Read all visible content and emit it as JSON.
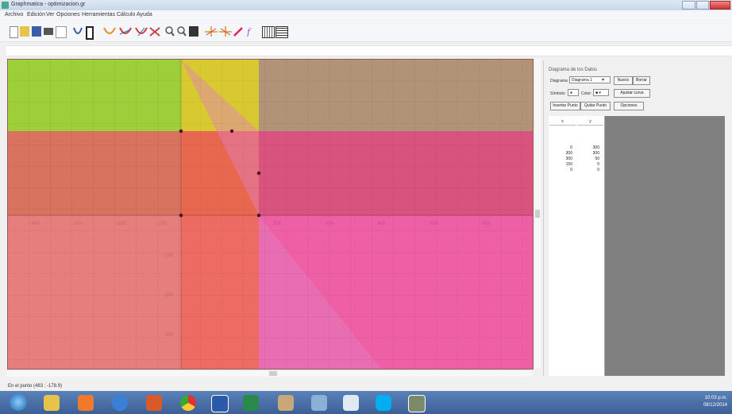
{
  "window": {
    "title": "Graphmatica - optimizacion.gr"
  },
  "menu": [
    "Archivo",
    "Edición",
    "Ver",
    "Opciones",
    "Herramientas",
    "Cálculo",
    "Ayuda"
  ],
  "toolbar_icons": [
    "new-file-icon",
    "open-folder-icon",
    "save-icon",
    "print-icon",
    "copy-icon",
    "draw-curve-icon",
    "table-icon",
    "tangent-icon",
    "derivative-icon",
    "integral-icon",
    "point-icon",
    "zoom-in-icon",
    "zoom-out-icon",
    "grid-icon",
    "polar-icon",
    "cartesian-icon",
    "pencil-icon",
    "formula-icon",
    "graph-paper-icon",
    "data-plot-icon"
  ],
  "input": {
    "value": ""
  },
  "graph": {
    "region_colors": [
      "#9dcf3a",
      "#d9c930",
      "#b19477",
      "#d7735e",
      "#e8684f",
      "#d8537d",
      "#e67e7e",
      "#ee6b63",
      "#ee5fa5",
      "#e07fc0"
    ],
    "x_ticks": [
      "-400",
      "-300",
      "-200",
      "-100",
      "100",
      "200",
      "300",
      "400",
      "500",
      "600",
      "700",
      "800",
      "900"
    ],
    "y_ticks": [
      "100",
      "200",
      "300",
      "400",
      "-100",
      "-200",
      "-300",
      "-400"
    ]
  },
  "panel": {
    "title": "Diagrama de los Datos",
    "diagram_label": "Diagrama:",
    "diagram_value": "Diagrama 1",
    "new_button": "Nuevo",
    "delete_button": "Borrar",
    "symbol_label": "Símbolo:",
    "color_label": "Color:",
    "fit_button": "Ajustar curva",
    "insert_button": "Insertar Punto",
    "remove_button": "Quitar Punto",
    "options_button": "Opciones",
    "table": {
      "headers": [
        "x",
        "y"
      ],
      "rows": [
        [
          "0",
          "300"
        ],
        [
          "300",
          "300"
        ],
        [
          "300",
          "50"
        ],
        [
          "150",
          "0"
        ],
        [
          "0",
          "0"
        ]
      ]
    }
  },
  "status": "En el punto (483 ; -178.9)",
  "clock": {
    "time": "10:03 p.m.",
    "date": "08/12/2014"
  }
}
